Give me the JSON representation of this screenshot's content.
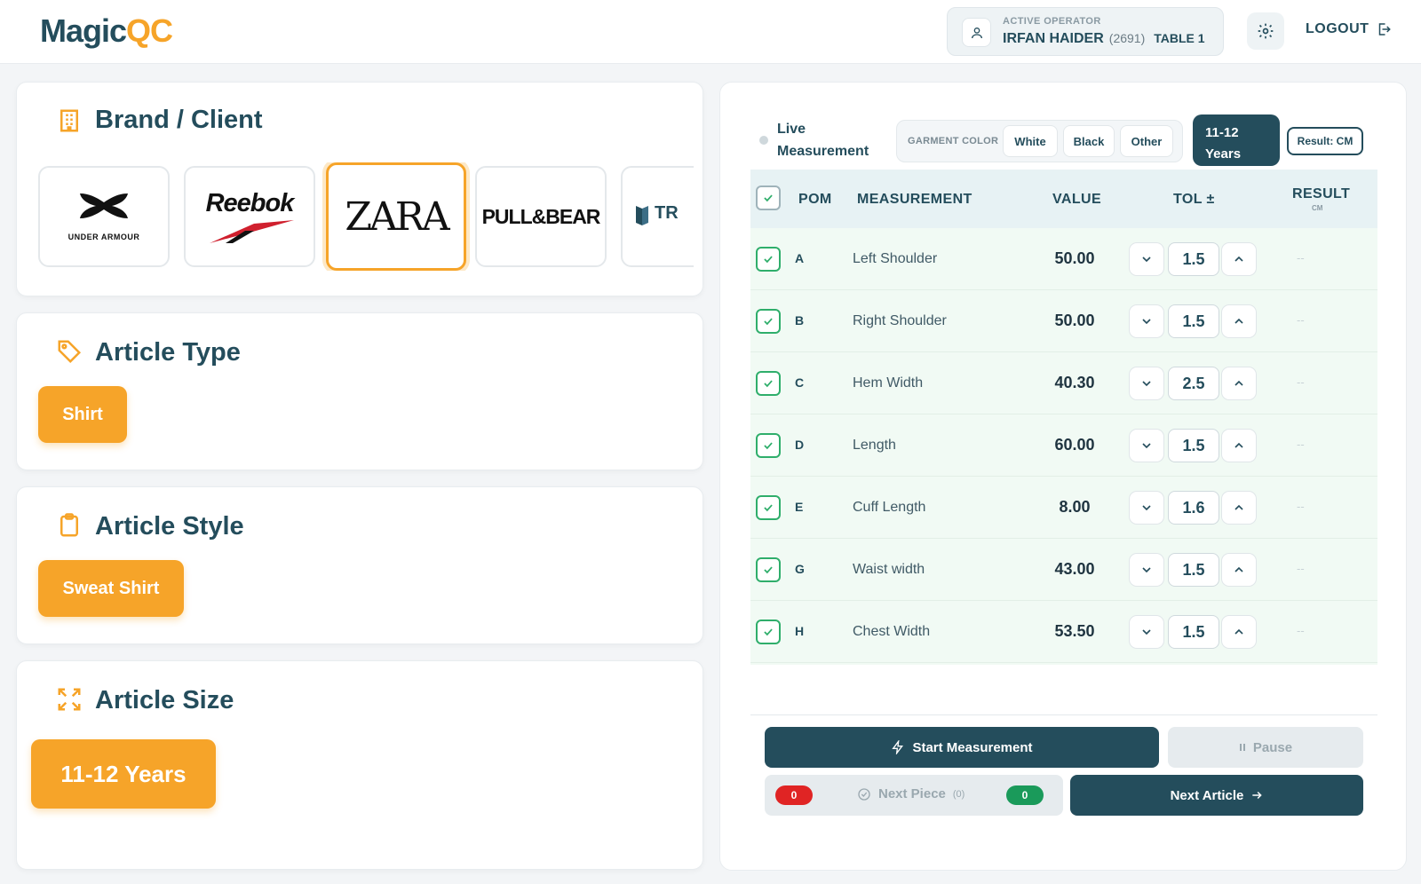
{
  "app": {
    "logo_part1": "Magic",
    "logo_part2": "QC"
  },
  "header": {
    "operator_caption": "ACTIVE OPERATOR",
    "operator_name": "IRFAN HAIDER",
    "operator_id": "(2691)",
    "table": "TABLE 1",
    "logout_label": "LOGOUT"
  },
  "brand_section": {
    "title": "Brand / Client",
    "brands": [
      {
        "name": "UNDER ARMOUR",
        "selected": false
      },
      {
        "name": "Reebok",
        "selected": false
      },
      {
        "name": "ZARA",
        "selected": true
      },
      {
        "name": "PULL&BEAR",
        "selected": false
      },
      {
        "name": "TR",
        "selected": false
      }
    ]
  },
  "article_type": {
    "title": "Article Type",
    "value": "Shirt"
  },
  "article_style": {
    "title": "Article Style",
    "value": "Sweat Shirt"
  },
  "article_size": {
    "title": "Article Size",
    "value": "11-12 Years"
  },
  "measurement": {
    "live_label_1": "Live",
    "live_label_2": "Measurement",
    "garment_color_caption": "GARMENT COLOR",
    "colors": [
      "White",
      "Black",
      "Other"
    ],
    "size_line1": "11-12",
    "size_line2": "Years",
    "result_unit_label": "Result: CM",
    "columns": {
      "pom": "POM",
      "measurement": "MEASUREMENT",
      "value": "VALUE",
      "tol": "TOL ±",
      "result": "RESULT",
      "result_unit": "CM"
    },
    "rows": [
      {
        "pom": "A",
        "measurement": "Left Shoulder",
        "value": "50.00",
        "tol": "1.5",
        "result": "--"
      },
      {
        "pom": "B",
        "measurement": "Right Shoulder",
        "value": "50.00",
        "tol": "1.5",
        "result": "--"
      },
      {
        "pom": "C",
        "measurement": "Hem Width",
        "value": "40.30",
        "tol": "2.5",
        "result": "--"
      },
      {
        "pom": "D",
        "measurement": "Length",
        "value": "60.00",
        "tol": "1.5",
        "result": "--"
      },
      {
        "pom": "E",
        "measurement": "Cuff Length",
        "value": "8.00",
        "tol": "1.6",
        "result": "--"
      },
      {
        "pom": "G",
        "measurement": "Waist width",
        "value": "43.00",
        "tol": "1.5",
        "result": "--"
      },
      {
        "pom": "H",
        "measurement": "Chest Width",
        "value": "53.50",
        "tol": "1.5",
        "result": "--"
      }
    ]
  },
  "actions": {
    "start_label": "Start Measurement",
    "pause_label": "Pause",
    "next_piece_label": "Next Piece",
    "next_piece_count": "(0)",
    "fail_count": "0",
    "pass_count": "0",
    "next_article_label": "Next Article"
  },
  "colors": {
    "accent": "#f6a429",
    "primary": "#244d5c",
    "pass": "#1a9a5a",
    "fail": "#e02424"
  }
}
